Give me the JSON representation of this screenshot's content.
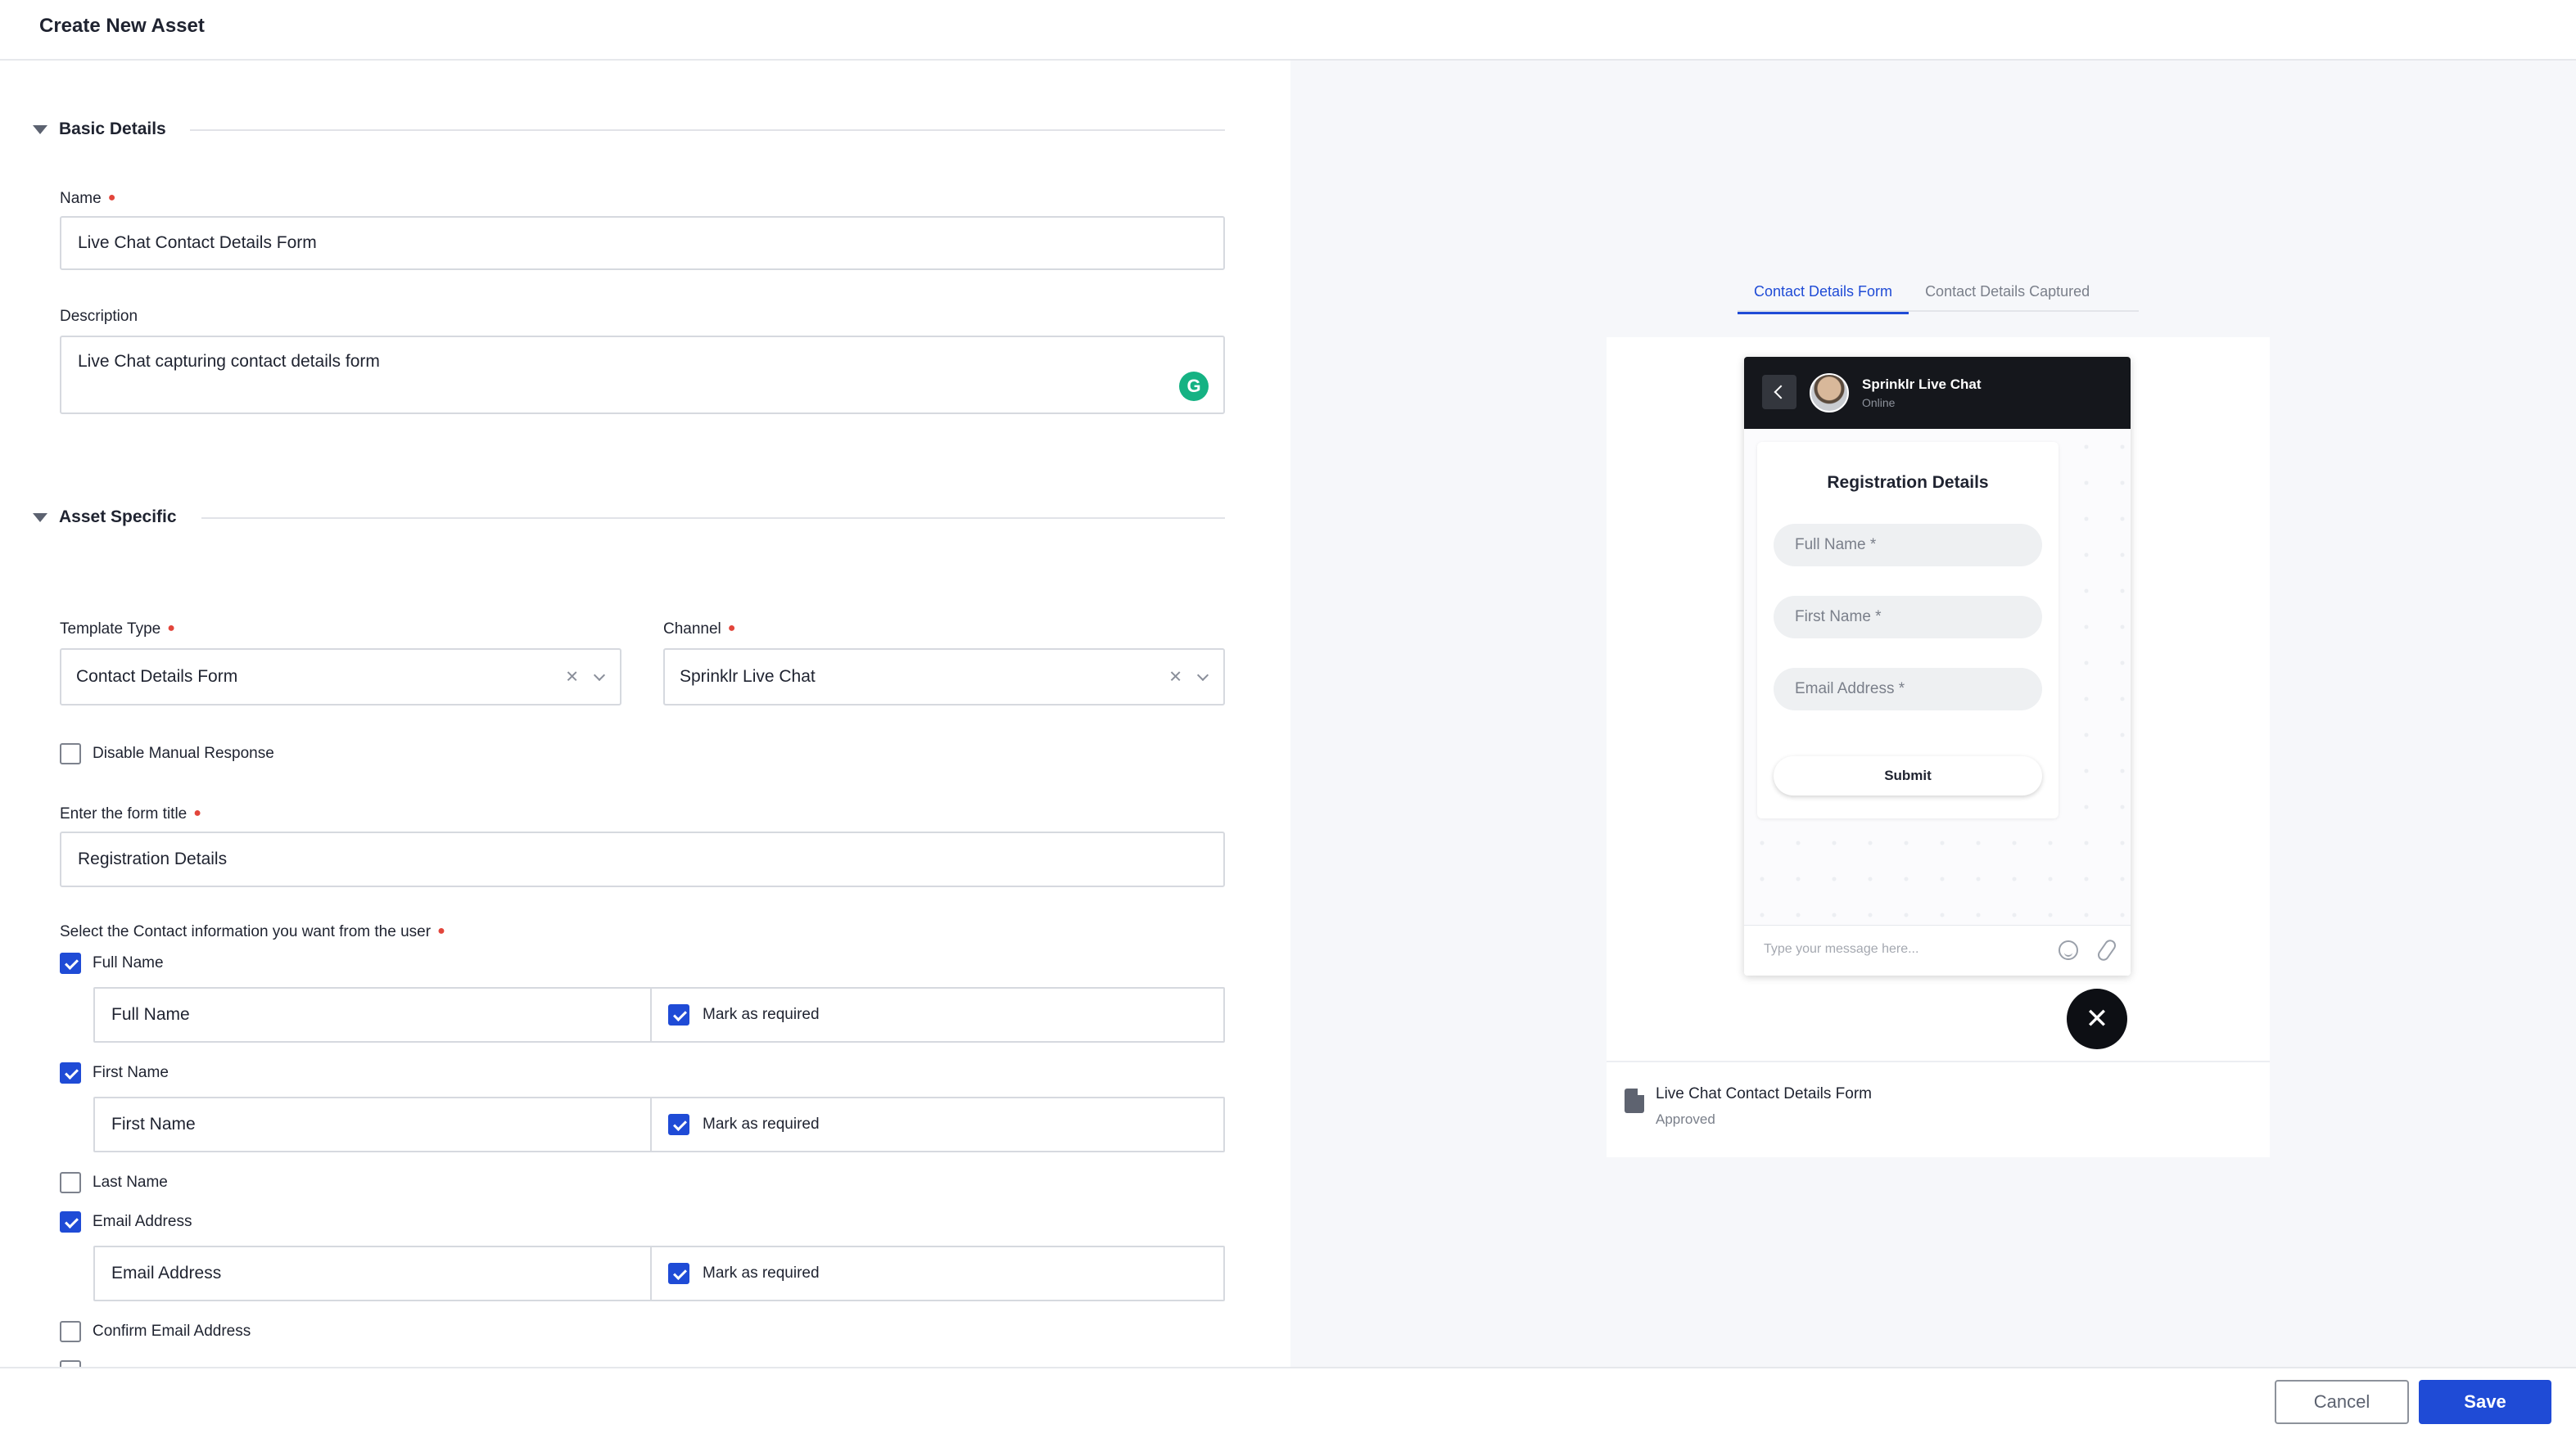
{
  "header": {
    "title": "Create New Asset"
  },
  "basic_details": {
    "section_title": "Basic Details",
    "name_label": "Name",
    "name_value": "Live Chat Contact Details Form",
    "description_label": "Description",
    "description_value": "Live Chat capturing contact details form"
  },
  "asset_specific": {
    "section_title": "Asset Specific",
    "template_type_label": "Template Type",
    "template_type_value": "Contact Details Form",
    "channel_label": "Channel",
    "channel_value": "Sprinklr Live Chat",
    "disable_manual_label": "Disable Manual Response",
    "form_title_label": "Enter the form title",
    "form_title_value": "Registration Details",
    "contact_info_label": "Select the Contact information you want from the user",
    "mark_required_label": "Mark as required",
    "fields": {
      "full_name": {
        "label": "Full Name",
        "value": "Full Name",
        "checked": true,
        "required": true
      },
      "first_name": {
        "label": "First Name",
        "value": "First Name",
        "checked": true,
        "required": true
      },
      "last_name": {
        "label": "Last Name",
        "checked": false
      },
      "email": {
        "label": "Email Address",
        "value": "Email Address",
        "checked": true,
        "required": true
      },
      "confirm_email": {
        "label": "Confirm Email Address",
        "checked": false
      }
    }
  },
  "preview": {
    "tabs": [
      "Contact Details Form",
      "Contact Details Captured"
    ],
    "chat_name": "Sprinklr Live Chat",
    "chat_status": "Online",
    "form_title": "Registration Details",
    "inputs": [
      "Full Name *",
      "First Name *",
      "Email Address *"
    ],
    "submit_label": "Submit",
    "composer_placeholder": "Type your message here...",
    "asset_name": "Live Chat Contact Details Form",
    "asset_status": "Approved"
  },
  "footer": {
    "cancel_label": "Cancel",
    "save_label": "Save"
  },
  "colors": {
    "accent": "#1f4bd6",
    "required": "#e2453b",
    "grammarly": "#15b283"
  }
}
